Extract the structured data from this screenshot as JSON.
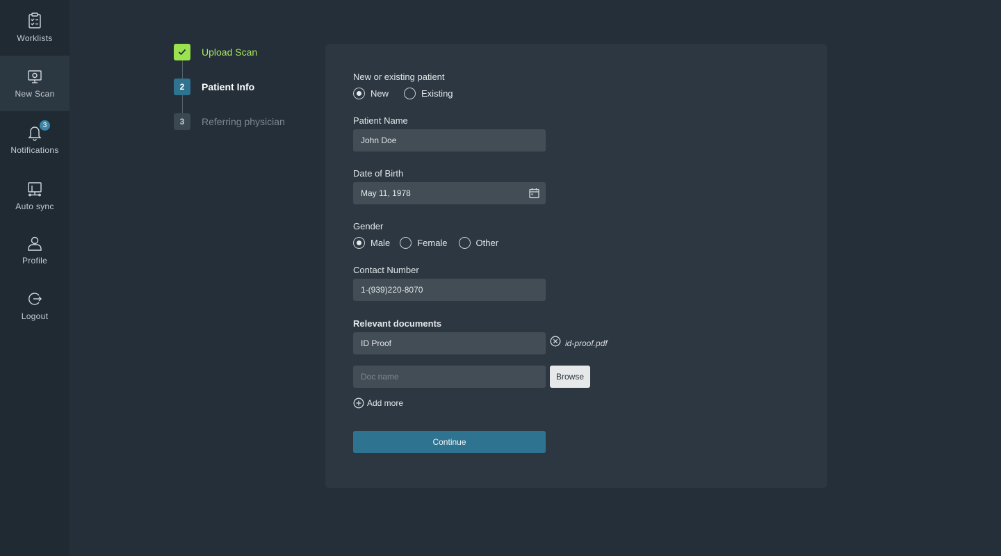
{
  "sidebar": {
    "items": [
      {
        "label": "Worklists",
        "icon": "clipboard-check-icon"
      },
      {
        "label": "New Scan",
        "icon": "monitor-scan-icon",
        "active": true
      },
      {
        "label": "Notifications",
        "icon": "bell-icon",
        "badge": "3"
      },
      {
        "label": "Auto sync",
        "icon": "sync-monitor-icon"
      },
      {
        "label": "Profile",
        "icon": "user-icon"
      },
      {
        "label": "Logout",
        "icon": "logout-icon"
      }
    ]
  },
  "stepper": {
    "steps": [
      {
        "number": "",
        "label": "Upload Scan",
        "state": "done"
      },
      {
        "number": "2",
        "label": "Patient Info",
        "state": "current"
      },
      {
        "number": "3",
        "label": "Referring physician",
        "state": "pending"
      }
    ]
  },
  "form": {
    "patient_type": {
      "label": "New or existing patient",
      "options": [
        "New",
        "Existing"
      ],
      "selected": "New"
    },
    "patient_name": {
      "label": "Patient Name",
      "value": "John Doe"
    },
    "dob": {
      "label": "Date of Birth",
      "value": "May 11, 1978"
    },
    "gender": {
      "label": "Gender",
      "options": [
        "Male",
        "Female",
        "Other"
      ],
      "selected": "Male"
    },
    "contact": {
      "label": "Contact Number",
      "value": "1-(939)220-8070"
    },
    "documents": {
      "label": "Relevant documents",
      "existing": {
        "name": "ID Proof",
        "file": "id-proof.pdf"
      },
      "new_placeholder": "Doc name",
      "browse_label": "Browse",
      "add_more_label": "Add more"
    },
    "continue_label": "Continue"
  },
  "colors": {
    "background": "#242f39",
    "sidebar": "#1f2a33",
    "card": "#2c3741",
    "input": "#424d56",
    "accent": "#2e7490",
    "done_step": "#9be24f",
    "done_label": "#a8e85c"
  }
}
